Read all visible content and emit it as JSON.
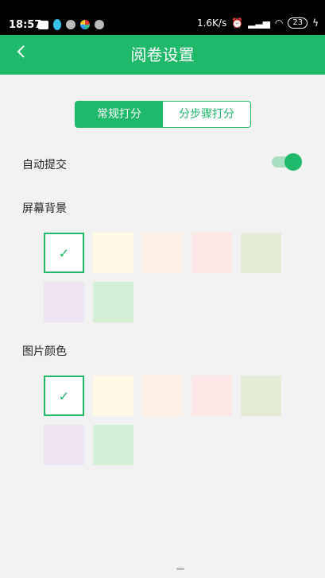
{
  "status": {
    "time": "18:57",
    "speed": "1.6K/s",
    "battery": "23"
  },
  "header": {
    "back_icon": "chevron-left-icon",
    "title": "阅卷设置"
  },
  "segment": {
    "tab1": "常规打分",
    "tab2": "分步骤打分"
  },
  "auto_submit": {
    "label": "自动提交",
    "enabled": true
  },
  "screen_bg": {
    "label": "屏幕背景",
    "colors": [
      "#ffffff",
      "#fff9e6",
      "#fff0e6",
      "#fde6e6",
      "#e5ecd6",
      "#ede3f2",
      "#d4f0d4"
    ],
    "selected_index": 0
  },
  "image_color": {
    "label": "图片颜色",
    "colors": [
      "#ffffff",
      "#fff9e6",
      "#fff0e6",
      "#fde6e6",
      "#e5ecd6",
      "#ede3f2",
      "#d4f0d4"
    ],
    "selected_index": 0
  },
  "accent_color": "#1fb96a"
}
